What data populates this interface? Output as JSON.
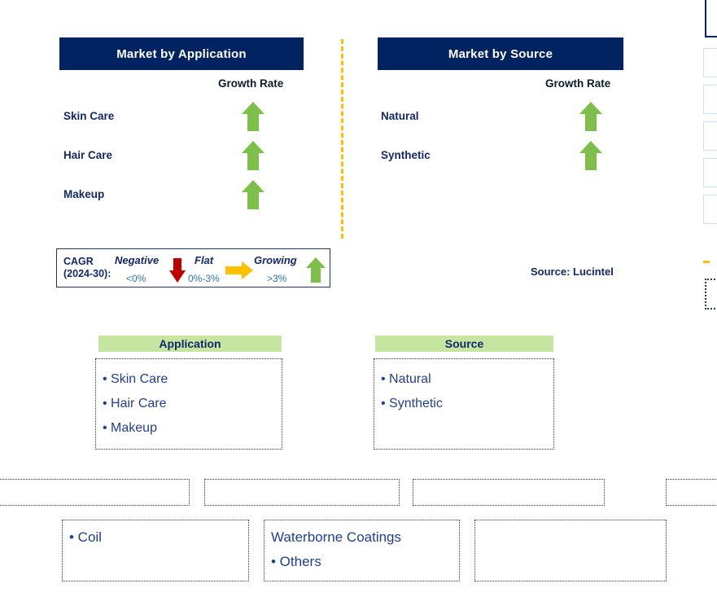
{
  "panels": [
    {
      "title": "Market by Application",
      "growth_rate_label": "Growth Rate",
      "rows": [
        {
          "label": "Skin Care",
          "trend": "growing",
          "trend_icon": "arrow-up-icon"
        },
        {
          "label": "Hair Care",
          "trend": "growing",
          "trend_icon": "arrow-up-icon"
        },
        {
          "label": "Makeup",
          "trend": "growing",
          "trend_icon": "arrow-up-icon"
        }
      ]
    },
    {
      "title": "Market by Source",
      "growth_rate_label": "Growth Rate",
      "rows": [
        {
          "label": "Natural",
          "trend": "growing",
          "trend_icon": "arrow-up-icon"
        },
        {
          "label": "Synthetic",
          "trend": "growing",
          "trend_icon": "arrow-up-icon"
        }
      ]
    }
  ],
  "legend": {
    "title_line1": "CAGR",
    "title_line2": "(2024-30):",
    "entries": [
      {
        "word": "Negative",
        "range": "<0%",
        "icon": "arrow-down-icon",
        "color": "#c00000"
      },
      {
        "word": "Flat",
        "range": "0%-3%",
        "icon": "arrow-right-icon",
        "color": "#ffc000"
      },
      {
        "word": "Growing",
        "range": ">3%",
        "icon": "arrow-up-icon",
        "color": "#7cc04b"
      }
    ]
  },
  "source_note": "Source: Lucintel",
  "segment_cards": [
    {
      "heading": "Application",
      "items": [
        "• Skin Care",
        "• Hair Care",
        "• Makeup"
      ]
    },
    {
      "heading": "Source",
      "items": [
        "• Natural",
        "• Synthetic"
      ]
    }
  ],
  "bottom_cards": [
    {
      "items": [
        "• Coil"
      ]
    },
    {
      "items": [
        "Waterborne Coatings",
        "• Others"
      ]
    },
    {
      "items": []
    }
  ],
  "colors": {
    "banner_navy": "#022361",
    "heading_green": "#c5e5a0",
    "arrow_green": "#7cc04b",
    "arrow_red": "#c00000",
    "arrow_orange": "#ffc000",
    "text_navy": "#12286b",
    "text_blue": "#1f3f93",
    "divider_orange": "#ffc000"
  }
}
